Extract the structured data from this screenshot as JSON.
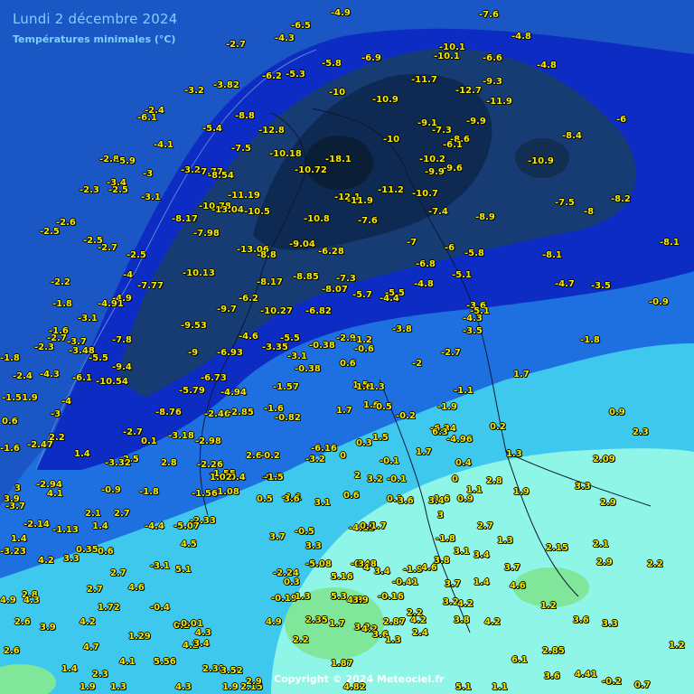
{
  "header": {
    "title": "Lundi 2 décembre 2024",
    "subtitle": "Températures minimales (°C)"
  },
  "footer": {
    "copyright": "Copyright © 2024 Meteociel.fr"
  },
  "colors": {
    "label_text": "#f8ec00",
    "sea": "#1a56c4",
    "band_very_cold": "#0f2a52",
    "band_cold": "#173c74",
    "band_cool": "#0c2cc4",
    "band_mild": "#1e6fe0",
    "band_positive": "#3ec8ee",
    "band_warm": "#8ff5e6"
  },
  "labels": [
    {
      "t": "-7.6"
    },
    {
      "t": "-4.9"
    },
    {
      "t": "-4.8"
    },
    {
      "t": "-6.5"
    },
    {
      "t": "-4.3"
    },
    {
      "t": "-2.7"
    },
    {
      "t": "-10.1"
    },
    {
      "t": "-10.1"
    },
    {
      "t": "-6.6"
    },
    {
      "t": "-5.8"
    },
    {
      "t": "-6.9"
    },
    {
      "t": "-4.8"
    },
    {
      "t": "-6.2"
    },
    {
      "t": "-5.3"
    },
    {
      "t": "-3.82"
    },
    {
      "t": "-3.2"
    },
    {
      "t": "-10"
    },
    {
      "t": "-10.9"
    },
    {
      "t": "-11.7"
    },
    {
      "t": "-12.7"
    },
    {
      "t": "-9.3"
    },
    {
      "t": "-11.9"
    },
    {
      "t": "-8.8"
    },
    {
      "t": "-2.4"
    },
    {
      "t": "-6.1"
    },
    {
      "t": "-5.4"
    },
    {
      "t": "-12.8"
    },
    {
      "t": "-9.1"
    },
    {
      "t": "-7.3"
    },
    {
      "t": "-9.9"
    },
    {
      "t": "-6"
    },
    {
      "t": "-4.1"
    },
    {
      "t": "-7.5"
    },
    {
      "t": "-10"
    },
    {
      "t": "-8.6"
    },
    {
      "t": "-6.1"
    },
    {
      "t": "-8.4"
    },
    {
      "t": "-2.8"
    },
    {
      "t": "-5.9"
    },
    {
      "t": "-10.18"
    },
    {
      "t": "-18.1"
    },
    {
      "t": "-10.2"
    },
    {
      "t": "-10.9"
    },
    {
      "t": "-3.2"
    },
    {
      "t": "-7.77"
    },
    {
      "t": "-10.72"
    },
    {
      "t": "-9.6"
    },
    {
      "t": "-9.9"
    },
    {
      "t": "-8.54"
    },
    {
      "t": "-3"
    },
    {
      "t": "-3.4"
    },
    {
      "t": "-2.5"
    },
    {
      "t": "-2.3"
    },
    {
      "t": "-11.2"
    },
    {
      "t": "-10.7"
    },
    {
      "t": "-11.19"
    },
    {
      "t": "-12.1"
    },
    {
      "t": "-11.9"
    },
    {
      "t": "-3.1"
    },
    {
      "t": "-10.78"
    },
    {
      "t": "-13.04"
    },
    {
      "t": "-10.5"
    },
    {
      "t": "-7.5"
    },
    {
      "t": "-8"
    },
    {
      "t": "-8.2"
    },
    {
      "t": "-7.4"
    },
    {
      "t": "-8.9"
    },
    {
      "t": "-8.17"
    },
    {
      "t": "-10.8"
    },
    {
      "t": "-7.6"
    },
    {
      "t": "-2.6"
    },
    {
      "t": "-2.5"
    },
    {
      "t": "-7.98"
    },
    {
      "t": "-2.5"
    },
    {
      "t": "-9.04"
    },
    {
      "t": "-7"
    },
    {
      "t": "-6"
    },
    {
      "t": "-8.1"
    },
    {
      "t": "-2.7"
    },
    {
      "t": "-13.06"
    },
    {
      "t": "-8.8"
    },
    {
      "t": "-6.28"
    },
    {
      "t": "-5.8"
    },
    {
      "t": "-8.1"
    },
    {
      "t": "-2.5"
    },
    {
      "t": "-6.8"
    },
    {
      "t": "-10.13"
    },
    {
      "t": "-4"
    },
    {
      "t": "-8.85"
    },
    {
      "t": "-5.1"
    },
    {
      "t": "-7.3"
    },
    {
      "t": "-8.17"
    },
    {
      "t": "-2.2"
    },
    {
      "t": "-7.77"
    },
    {
      "t": "-4.8"
    },
    {
      "t": "-4.7"
    },
    {
      "t": "-3.5"
    },
    {
      "t": "-8.07"
    },
    {
      "t": "-5.7"
    },
    {
      "t": "-5.5"
    },
    {
      "t": "-4.4"
    },
    {
      "t": "-4.9"
    },
    {
      "t": "-6.2"
    },
    {
      "t": "-1.8"
    },
    {
      "t": "-4.91"
    },
    {
      "t": "-9.7"
    },
    {
      "t": "-10.27"
    },
    {
      "t": "-6.82"
    },
    {
      "t": "-3.6"
    },
    {
      "t": "-5.1"
    },
    {
      "t": "-0.9"
    },
    {
      "t": "-3.1"
    },
    {
      "t": "-4.3"
    },
    {
      "t": "-9.53"
    },
    {
      "t": "-3.5"
    },
    {
      "t": "-1.6"
    },
    {
      "t": "-3.8"
    },
    {
      "t": "-4.6"
    },
    {
      "t": "-5.5"
    },
    {
      "t": "-2.9"
    },
    {
      "t": "-1.8"
    },
    {
      "t": "-2.7"
    },
    {
      "t": "-3.7"
    },
    {
      "t": "-7.8"
    },
    {
      "t": "-3.35"
    },
    {
      "t": "-0.38"
    },
    {
      "t": "-1.2"
    },
    {
      "t": "-2.3"
    },
    {
      "t": "-3.48"
    },
    {
      "t": "-0.6"
    },
    {
      "t": "-9"
    },
    {
      "t": "-6.93"
    },
    {
      "t": "-3.1"
    },
    {
      "t": "-2.7"
    },
    {
      "t": "-1.8"
    },
    {
      "t": "-5.5"
    },
    {
      "t": "-9.4"
    },
    {
      "t": "0.6"
    },
    {
      "t": "-2"
    },
    {
      "t": "-0.38"
    },
    {
      "t": "-4.3"
    },
    {
      "t": "-2.4"
    },
    {
      "t": "-6.1"
    },
    {
      "t": "-10.54"
    },
    {
      "t": "-6.73"
    },
    {
      "t": "1.7"
    },
    {
      "t": "-1.57"
    },
    {
      "t": "1.5"
    },
    {
      "t": "1.6"
    },
    {
      "t": "1.3"
    },
    {
      "t": "-1.5"
    },
    {
      "t": "1.9"
    },
    {
      "t": "-5.79"
    },
    {
      "t": "-4.94"
    },
    {
      "t": "-1.1"
    },
    {
      "t": "-4"
    },
    {
      "t": "-1.9"
    },
    {
      "t": "-1.6"
    },
    {
      "t": "1.6"
    },
    {
      "t": "-0.5"
    },
    {
      "t": "-3"
    },
    {
      "t": "0.6"
    },
    {
      "t": "-8.76"
    },
    {
      "t": "-2.46"
    },
    {
      "t": "-2.85"
    },
    {
      "t": "-0.82"
    },
    {
      "t": "1.7"
    },
    {
      "t": "-0.2"
    },
    {
      "t": "0.9"
    },
    {
      "t": "-6.34"
    },
    {
      "t": "6.3"
    },
    {
      "t": "0.2"
    },
    {
      "t": "2.2"
    },
    {
      "t": "-2.7"
    },
    {
      "t": "-4.96"
    },
    {
      "t": "2.3"
    },
    {
      "t": "1.5"
    },
    {
      "t": "0.3"
    },
    {
      "t": "0.1"
    },
    {
      "t": "-3.18"
    },
    {
      "t": "-2.98"
    },
    {
      "t": "-2.47"
    },
    {
      "t": "-1.6"
    },
    {
      "t": "1.4"
    },
    {
      "t": "-6.16"
    },
    {
      "t": "1.7"
    },
    {
      "t": "1.3"
    },
    {
      "t": "2.6"
    },
    {
      "t": "-0.2"
    },
    {
      "t": "2.09"
    },
    {
      "t": "2.5"
    },
    {
      "t": "-3.32"
    },
    {
      "t": "-3.2"
    },
    {
      "t": "2"
    },
    {
      "t": "0"
    },
    {
      "t": "0.4"
    },
    {
      "t": "2.8"
    },
    {
      "t": "-2.26"
    },
    {
      "t": "-1.55"
    },
    {
      "t": "-0.2"
    },
    {
      "t": "0.4"
    },
    {
      "t": "1.02"
    },
    {
      "t": "-0.1"
    },
    {
      "t": "0"
    },
    {
      "t": "2.8"
    },
    {
      "t": "3.2"
    },
    {
      "t": "-0.1"
    },
    {
      "t": "1.1"
    },
    {
      "t": "3.3"
    },
    {
      "t": "3"
    },
    {
      "t": "-0.9"
    },
    {
      "t": "-1.8"
    },
    {
      "t": "-1.08"
    },
    {
      "t": "-1.56"
    },
    {
      "t": "-1.5"
    },
    {
      "t": "1.9"
    },
    {
      "t": "1.6"
    },
    {
      "t": "4.1"
    },
    {
      "t": "-2.94"
    },
    {
      "t": "-1.1"
    },
    {
      "t": "0.6"
    },
    {
      "t": "0.1"
    },
    {
      "t": "3.6"
    },
    {
      "t": "3.4"
    },
    {
      "t": "3.6"
    },
    {
      "t": "0.5"
    },
    {
      "t": "3.1"
    },
    {
      "t": "0.9"
    },
    {
      "t": "2.9"
    },
    {
      "t": "3.9"
    },
    {
      "t": "-3.7"
    },
    {
      "t": "3"
    },
    {
      "t": "2.1"
    },
    {
      "t": "2.7"
    },
    {
      "t": "-2.33"
    },
    {
      "t": "-2.14"
    },
    {
      "t": "1.4"
    },
    {
      "t": "-4.4"
    },
    {
      "t": "-5.07"
    },
    {
      "t": "-1.13"
    },
    {
      "t": "-0.5"
    },
    {
      "t": "-4.15"
    },
    {
      "t": "0.7"
    },
    {
      "t": "1.7"
    },
    {
      "t": "2.7"
    },
    {
      "t": "1.4"
    },
    {
      "t": "3.7"
    },
    {
      "t": "-1.8"
    },
    {
      "t": "1.3"
    },
    {
      "t": "4.5"
    },
    {
      "t": "3.3"
    },
    {
      "t": "0.35"
    },
    {
      "t": "0.6"
    },
    {
      "t": "-3.23"
    },
    {
      "t": "2.15"
    },
    {
      "t": "2.1"
    },
    {
      "t": "3.1"
    },
    {
      "t": "4.2"
    },
    {
      "t": "3.3"
    },
    {
      "t": "-3.1"
    },
    {
      "t": "-5.08"
    },
    {
      "t": "-0.48"
    },
    {
      "t": "3"
    },
    {
      "t": "3.8"
    },
    {
      "t": "3.4"
    },
    {
      "t": "2.9"
    },
    {
      "t": "2.2"
    },
    {
      "t": "4"
    },
    {
      "t": "3.4"
    },
    {
      "t": "-1.9"
    },
    {
      "t": "4.6"
    },
    {
      "t": "3.7"
    },
    {
      "t": "2.7"
    },
    {
      "t": "5.1"
    },
    {
      "t": "-2.24"
    },
    {
      "t": "5.16"
    },
    {
      "t": "2.8"
    },
    {
      "t": "4.6"
    },
    {
      "t": "0.3"
    },
    {
      "t": "-0.41"
    },
    {
      "t": "3.7"
    },
    {
      "t": "1.4"
    },
    {
      "t": "4.6"
    },
    {
      "t": "2.7"
    },
    {
      "t": "5.3"
    },
    {
      "t": "-0.16"
    },
    {
      "t": "4.3"
    },
    {
      "t": "4.9"
    },
    {
      "t": "4.3"
    },
    {
      "t": "1.72"
    },
    {
      "t": "-0.4"
    },
    {
      "t": "-0.19"
    },
    {
      "t": "1.3"
    },
    {
      "t": "3.9"
    },
    {
      "t": "3.2"
    },
    {
      "t": "4.2"
    },
    {
      "t": "2.6"
    },
    {
      "t": "4.2"
    },
    {
      "t": "0.2"
    },
    {
      "t": "-0.01"
    },
    {
      "t": "2.35"
    },
    {
      "t": "2.2"
    },
    {
      "t": "4.2"
    },
    {
      "t": "3.3"
    },
    {
      "t": "3.9"
    },
    {
      "t": "3.2"
    },
    {
      "t": "1.29"
    },
    {
      "t": "3.8"
    },
    {
      "t": "3.6"
    },
    {
      "t": "4.9"
    },
    {
      "t": "4.3"
    },
    {
      "t": "1.7"
    },
    {
      "t": "2.87"
    },
    {
      "t": "4.2"
    },
    {
      "t": "4.2"
    },
    {
      "t": "2.4"
    },
    {
      "t": "3.6"
    },
    {
      "t": "1.2"
    },
    {
      "t": "4.2"
    },
    {
      "t": "2.2"
    },
    {
      "t": "1.3"
    },
    {
      "t": "4.7"
    },
    {
      "t": "3.4"
    },
    {
      "t": "2.85"
    },
    {
      "t": "1.2"
    },
    {
      "t": "2.6"
    },
    {
      "t": "2.3"
    },
    {
      "t": "1.4"
    },
    {
      "t": "4.1"
    },
    {
      "t": "5.56"
    },
    {
      "t": "2.31"
    },
    {
      "t": "1.87"
    },
    {
      "t": "3.52"
    },
    {
      "t": "6.1"
    },
    {
      "t": "4.41"
    },
    {
      "t": "1.9"
    },
    {
      "t": "1.3"
    },
    {
      "t": "4.3"
    },
    {
      "t": "2.15"
    },
    {
      "t": "1.9"
    },
    {
      "t": "2.9"
    },
    {
      "t": "4.82"
    },
    {
      "t": "5.1"
    },
    {
      "t": "3.6"
    },
    {
      "t": "1.1"
    },
    {
      "t": "0.7"
    },
    {
      "t": "-0.2"
    },
    {
      "t": "1.4"
    },
    {
      "t": "1.3"
    }
  ]
}
